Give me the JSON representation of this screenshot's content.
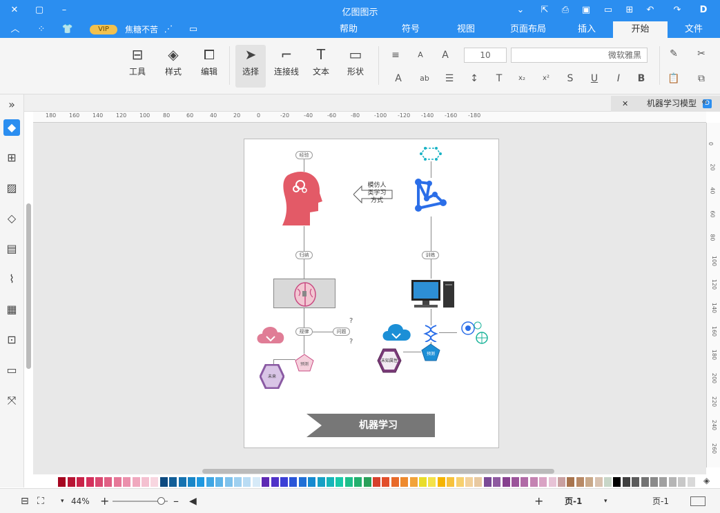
{
  "window": {
    "title": "亿图图示"
  },
  "menu_tabs": [
    {
      "label": "文件"
    },
    {
      "label": "开始"
    },
    {
      "label": "插入"
    },
    {
      "label": "页面布局"
    },
    {
      "label": "视图"
    },
    {
      "label": "符号"
    },
    {
      "label": "帮助"
    }
  ],
  "account": {
    "user": "焦糖不苦",
    "vip": "VIP"
  },
  "ribbon": {
    "font_family": "微软雅黑",
    "font_size": "10",
    "tools": [
      {
        "label": "形状"
      },
      {
        "label": "文本"
      },
      {
        "label": "连接线"
      },
      {
        "label": "选择"
      },
      {
        "label": "编辑"
      },
      {
        "label": "样式"
      },
      {
        "label": "工具"
      }
    ]
  },
  "document": {
    "tab_title": "机器学习模型"
  },
  "ruler": {
    "h_ticks": [
      "180",
      "160",
      "140",
      "120",
      "100",
      "80",
      "60",
      "40",
      "20",
      "0",
      "-20",
      "-40",
      "-60",
      "-80",
      "-100",
      "-120",
      "-140",
      "-160",
      "-180"
    ],
    "v_ticks": [
      "0",
      "20",
      "40",
      "60",
      "80",
      "100",
      "120",
      "140",
      "160",
      "180",
      "200",
      "220",
      "240",
      "260"
    ]
  },
  "diagram": {
    "banner": "机器学习",
    "left": {
      "top_label": "经验",
      "mid_label": "归纳",
      "bottom_label": "规律",
      "question_label": "问题",
      "predict_label": "预测",
      "future_label": "未来"
    },
    "middle": {
      "arrow_lines": [
        "模仿人",
        "类学习",
        "方式"
      ]
    },
    "right": {
      "mid_label": "训练",
      "predict_label": "预测",
      "future_label": "未知属性"
    }
  },
  "status": {
    "page_selector": "页-1",
    "page_tab": "页-1",
    "add_page": "+",
    "zoom": "44%"
  },
  "colors": {
    "accent": "#2b8ef0",
    "head": "#e35a67",
    "banner": "#777777"
  }
}
